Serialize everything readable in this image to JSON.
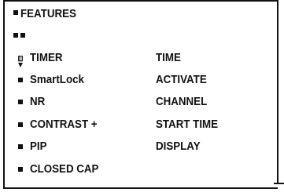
{
  "menu": {
    "title": "FEATURES",
    "nav_markers": "■■",
    "items": [
      {
        "label": "TIMER",
        "option": "TIME",
        "icon": "arrow-down-cursor-icon"
      },
      {
        "label": "SmartLock",
        "option": "ACTIVATE",
        "icon": "square-bullet-icon"
      },
      {
        "label": "NR",
        "option": "CHANNEL",
        "icon": "square-bullet-icon"
      },
      {
        "label": "CONTRAST +",
        "option": "START TIME",
        "icon": "square-bullet-icon"
      },
      {
        "label": "PIP",
        "option": "DISPLAY",
        "icon": "square-bullet-icon"
      },
      {
        "label": "CLOSED CAP",
        "option": "",
        "icon": "square-bullet-icon"
      }
    ]
  },
  "colors": {
    "text": "#111111",
    "background": "#ffffff"
  }
}
